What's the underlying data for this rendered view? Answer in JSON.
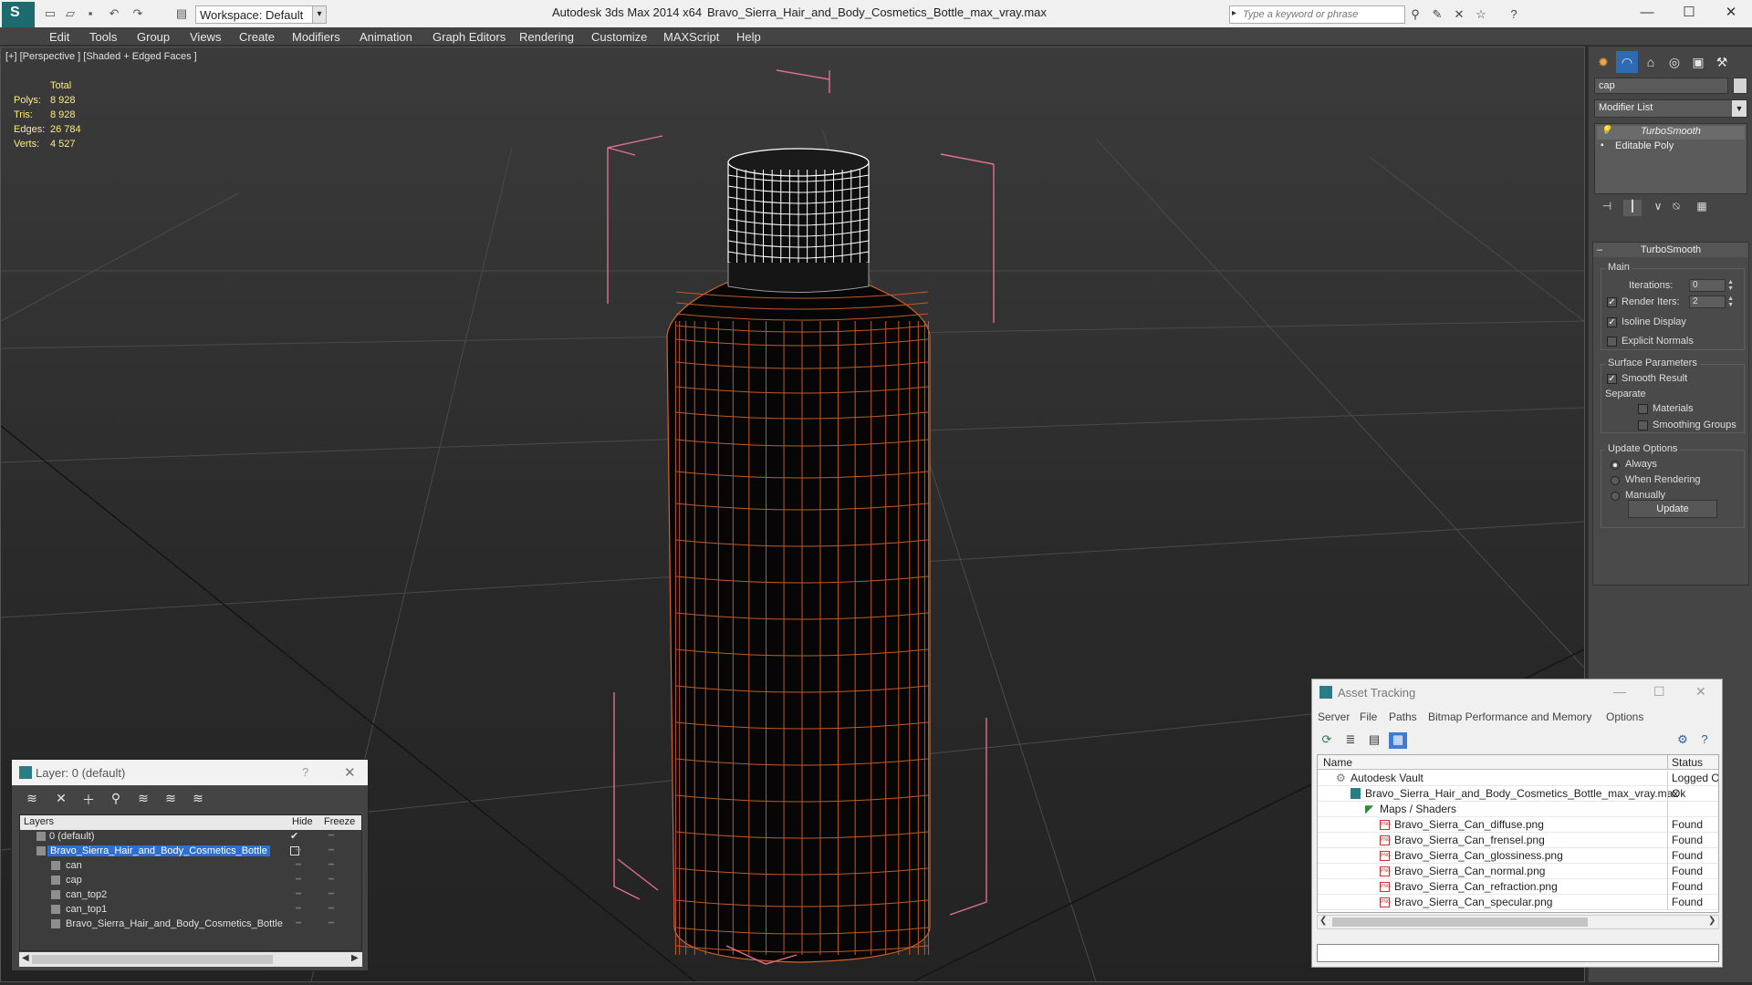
{
  "titlebar": {
    "workspace": "Workspace: Default",
    "app_title": "Autodesk 3ds Max  2014 x64",
    "file_title": "Bravo_Sierra_Hair_and_Body_Cosmetics_Bottle_max_vray.max",
    "search_placeholder": "Type a keyword or phrase"
  },
  "menu": [
    "Edit",
    "Tools",
    "Group",
    "Views",
    "Create",
    "Modifiers",
    "Animation",
    "Graph Editors",
    "Rendering",
    "Customize",
    "MAXScript",
    "Help"
  ],
  "viewport": {
    "label": "[+] [Perspective ] [Shaded + Edged Faces ]",
    "stats": {
      "header": "Total",
      "rows": [
        {
          "k": "Polys:",
          "v": "8 928"
        },
        {
          "k": "Tris:",
          "v": "8 928"
        },
        {
          "k": "Edges:",
          "v": "26 784"
        },
        {
          "k": "Verts:",
          "v": "4 527"
        }
      ]
    }
  },
  "command_panel": {
    "object_name": "cap",
    "modifier_list": "Modifier List",
    "stack": [
      "TurboSmooth",
      "Editable Poly"
    ],
    "rollout_title": "TurboSmooth",
    "main_label": "Main",
    "iterations_label": "Iterations:",
    "iterations_value": "0",
    "render_iters_label": "Render Iters:",
    "render_iters_value": "2",
    "isoline_label": "Isoline Display",
    "explicit_label": "Explicit Normals",
    "surface_label": "Surface Parameters",
    "smooth_label": "Smooth Result",
    "separate_label": "Separate",
    "materials_label": "Materials",
    "smoothing_label": "Smoothing Groups",
    "update_options_label": "Update Options",
    "always_label": "Always",
    "when_rendering_label": "When Rendering",
    "manually_label": "Manually",
    "update_button": "Update"
  },
  "layer_window": {
    "title": "Layer: 0 (default)",
    "help": "?",
    "col_layers": "Layers",
    "col_hide": "Hide",
    "col_freeze": "Freeze",
    "rows": [
      {
        "name": "0 (default)",
        "level": 0
      },
      {
        "name": "Bravo_Sierra_Hair_and_Body_Cosmetics_Bottle",
        "level": 0
      },
      {
        "name": "can",
        "level": 1
      },
      {
        "name": "cap",
        "level": 1
      },
      {
        "name": "can_top2",
        "level": 1
      },
      {
        "name": "can_top1",
        "level": 1
      },
      {
        "name": "Bravo_Sierra_Hair_and_Body_Cosmetics_Bottle",
        "level": 1
      }
    ]
  },
  "asset_tracking": {
    "title": "Asset Tracking",
    "menu": [
      "Server",
      "File",
      "Paths",
      "Bitmap Performance and Memory",
      "Options"
    ],
    "col_name": "Name",
    "col_status": "Status",
    "rows": [
      {
        "name": "Autodesk Vault",
        "status": "Logged Ou",
        "indent": 1
      },
      {
        "name": "Bravo_Sierra_Hair_and_Body_Cosmetics_Bottle_max_vray.max",
        "status": "Ok",
        "indent": 2
      },
      {
        "name": "Maps / Shaders",
        "status": "",
        "indent": 3
      },
      {
        "name": "Bravo_Sierra_Can_diffuse.png",
        "status": "Found",
        "indent": 4
      },
      {
        "name": "Bravo_Sierra_Can_frensel.png",
        "status": "Found",
        "indent": 4
      },
      {
        "name": "Bravo_Sierra_Can_glossiness.png",
        "status": "Found",
        "indent": 4
      },
      {
        "name": "Bravo_Sierra_Can_normal.png",
        "status": "Found",
        "indent": 4
      },
      {
        "name": "Bravo_Sierra_Can_refraction.png",
        "status": "Found",
        "indent": 4
      },
      {
        "name": "Bravo_Sierra_Can_specular.png",
        "status": "Found",
        "indent": 4
      }
    ]
  },
  "colors": {
    "wire_orange": "#d8652a",
    "selection_pink": "#e0708e",
    "cap_wire": "#ffffff",
    "stats_yellow": "#ffec7a",
    "selected_blue": "#2e6fd2"
  }
}
